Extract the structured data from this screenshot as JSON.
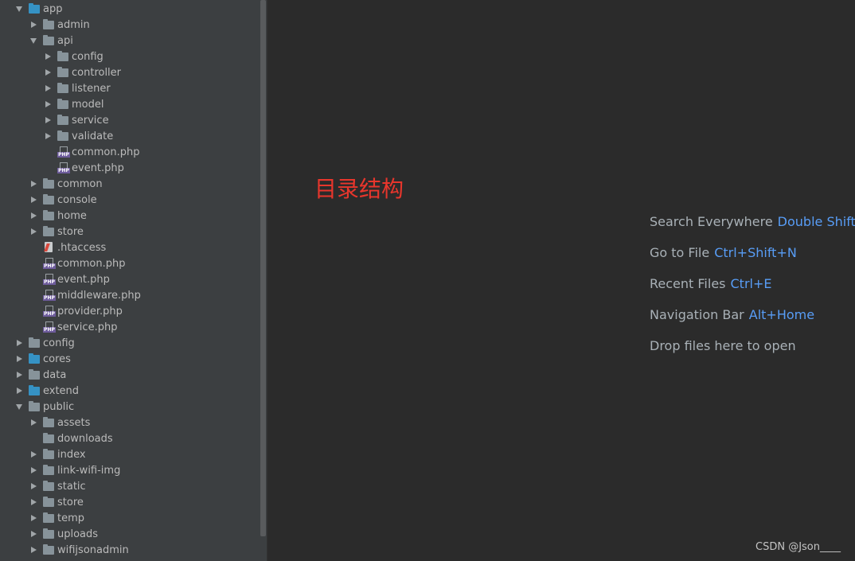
{
  "project_tree": {
    "nodes": [
      {
        "label": "app",
        "depth": 0,
        "kind": "folder",
        "state": "expanded",
        "color": "blue"
      },
      {
        "label": "admin",
        "depth": 1,
        "kind": "folder",
        "state": "collapsed"
      },
      {
        "label": "api",
        "depth": 1,
        "kind": "folder",
        "state": "expanded"
      },
      {
        "label": "config",
        "depth": 2,
        "kind": "folder",
        "state": "collapsed"
      },
      {
        "label": "controller",
        "depth": 2,
        "kind": "folder",
        "state": "collapsed"
      },
      {
        "label": "listener",
        "depth": 2,
        "kind": "folder",
        "state": "collapsed"
      },
      {
        "label": "model",
        "depth": 2,
        "kind": "folder",
        "state": "collapsed"
      },
      {
        "label": "service",
        "depth": 2,
        "kind": "folder",
        "state": "collapsed"
      },
      {
        "label": "validate",
        "depth": 2,
        "kind": "folder",
        "state": "collapsed"
      },
      {
        "label": "common.php",
        "depth": 2,
        "kind": "php"
      },
      {
        "label": "event.php",
        "depth": 2,
        "kind": "php"
      },
      {
        "label": "common",
        "depth": 1,
        "kind": "folder",
        "state": "collapsed"
      },
      {
        "label": "console",
        "depth": 1,
        "kind": "folder",
        "state": "collapsed"
      },
      {
        "label": "home",
        "depth": 1,
        "kind": "folder",
        "state": "collapsed"
      },
      {
        "label": "store",
        "depth": 1,
        "kind": "folder",
        "state": "collapsed"
      },
      {
        "label": ".htaccess",
        "depth": 1,
        "kind": "htaccess"
      },
      {
        "label": "common.php",
        "depth": 1,
        "kind": "php"
      },
      {
        "label": "event.php",
        "depth": 1,
        "kind": "php"
      },
      {
        "label": "middleware.php",
        "depth": 1,
        "kind": "php"
      },
      {
        "label": "provider.php",
        "depth": 1,
        "kind": "php"
      },
      {
        "label": "service.php",
        "depth": 1,
        "kind": "php"
      },
      {
        "label": "config",
        "depth": 0,
        "kind": "folder",
        "state": "collapsed"
      },
      {
        "label": "cores",
        "depth": 0,
        "kind": "folder",
        "state": "collapsed",
        "color": "blue"
      },
      {
        "label": "data",
        "depth": 0,
        "kind": "folder",
        "state": "collapsed"
      },
      {
        "label": "extend",
        "depth": 0,
        "kind": "folder",
        "state": "collapsed",
        "color": "blue"
      },
      {
        "label": "public",
        "depth": 0,
        "kind": "folder",
        "state": "expanded"
      },
      {
        "label": "assets",
        "depth": 1,
        "kind": "folder",
        "state": "collapsed"
      },
      {
        "label": "downloads",
        "depth": 1,
        "kind": "folder",
        "state": "leaf"
      },
      {
        "label": "index",
        "depth": 1,
        "kind": "folder",
        "state": "collapsed"
      },
      {
        "label": "link-wifi-img",
        "depth": 1,
        "kind": "folder",
        "state": "collapsed"
      },
      {
        "label": "static",
        "depth": 1,
        "kind": "folder",
        "state": "collapsed"
      },
      {
        "label": "store",
        "depth": 1,
        "kind": "folder",
        "state": "collapsed"
      },
      {
        "label": "temp",
        "depth": 1,
        "kind": "folder",
        "state": "collapsed"
      },
      {
        "label": "uploads",
        "depth": 1,
        "kind": "folder",
        "state": "collapsed"
      },
      {
        "label": "wifijsonadmin",
        "depth": 1,
        "kind": "folder",
        "state": "collapsed"
      }
    ]
  },
  "annotation": "目录结构",
  "editor_empty_hints": [
    {
      "text": "Search Everywhere",
      "shortcut": "Double Shift"
    },
    {
      "text": "Go to File",
      "shortcut": "Ctrl+Shift+N"
    },
    {
      "text": "Recent Files",
      "shortcut": "Ctrl+E"
    },
    {
      "text": "Navigation Bar",
      "shortcut": "Alt+Home"
    },
    {
      "text": "Drop files here to open",
      "shortcut": ""
    }
  ],
  "watermark": "CSDN @Json____",
  "colors": {
    "tree_bg": "#3c3f41",
    "editor_bg": "#2b2b2b",
    "tree_text": "#bbbbbb",
    "hint_text": "#a9b1b7",
    "shortcut": "#589df6",
    "annotation": "#e8362c"
  }
}
